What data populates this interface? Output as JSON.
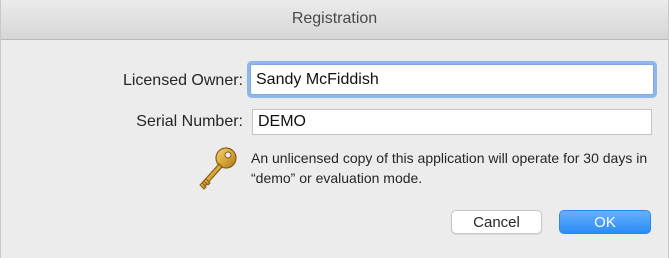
{
  "window": {
    "title": "Registration"
  },
  "form": {
    "owner_label": "Licensed Owner:",
    "owner_value": "Sandy McFiddish",
    "serial_label": "Serial Number:",
    "serial_value": "DEMO"
  },
  "notice": {
    "icon": "key-icon",
    "text": "An unlicensed copy of this application will operate for 30 days in “demo” or evaluation mode."
  },
  "buttons": {
    "cancel_label": "Cancel",
    "ok_label": "OK"
  },
  "colors": {
    "accent": "#2a8cf7",
    "focus_ring": "#8db6ec",
    "window_bg": "#ececec"
  }
}
